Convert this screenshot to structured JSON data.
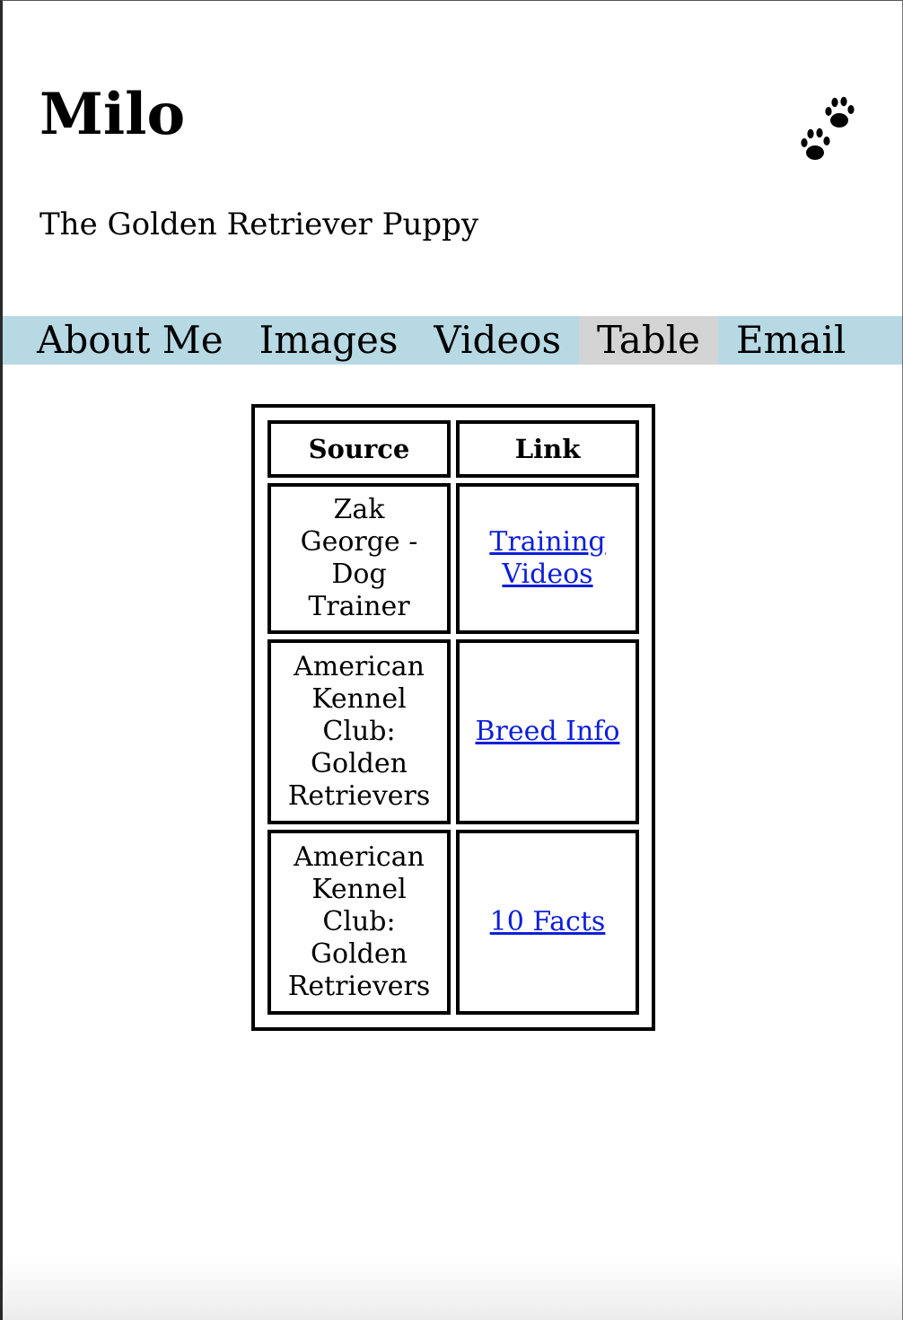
{
  "site": {
    "title": "Milo",
    "tagline": "The Golden Retriever Puppy",
    "logo_icon": "paw-prints-icon"
  },
  "nav": {
    "items": [
      {
        "label": "About Me",
        "active": false
      },
      {
        "label": "Images",
        "active": false
      },
      {
        "label": "Videos",
        "active": false
      },
      {
        "label": "Table",
        "active": true
      },
      {
        "label": "Email",
        "active": false
      }
    ],
    "background_color": "#b7d9e4",
    "active_color": "#d4d4d4"
  },
  "table": {
    "headers": {
      "source": "Source",
      "link": "Link"
    },
    "rows": [
      {
        "source": "Zak George - Dog Trainer",
        "link": "Training Videos"
      },
      {
        "source": "American Kennel Club: Golden Retrievers",
        "link": "Breed Info"
      },
      {
        "source": "American Kennel Club: Golden Retrievers",
        "link": "10 Facts"
      }
    ],
    "link_color": "#0d1fd8"
  }
}
